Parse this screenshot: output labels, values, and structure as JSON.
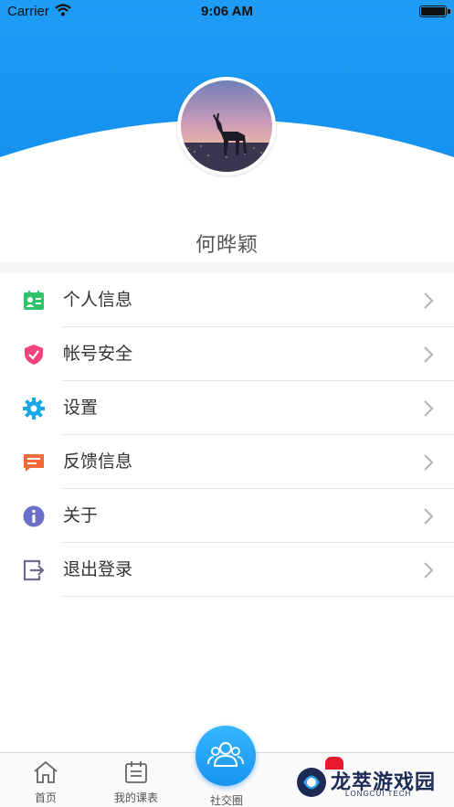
{
  "status_bar": {
    "carrier": "Carrier",
    "time": "9:06 AM"
  },
  "profile": {
    "username": "何晔颖"
  },
  "menu": {
    "items": [
      {
        "label": "个人信息",
        "icon": "id-card-icon",
        "color": "#2fc46a"
      },
      {
        "label": "帐号安全",
        "icon": "shield-check-icon",
        "color": "#f4427c"
      },
      {
        "label": "设置",
        "icon": "gear-icon",
        "color": "#1aa8e8"
      },
      {
        "label": "反馈信息",
        "icon": "message-icon",
        "color": "#f26a3a"
      },
      {
        "label": "关于",
        "icon": "info-icon",
        "color": "#6b6fc7"
      },
      {
        "label": "退出登录",
        "icon": "logout-icon",
        "color": "#6e6c8e"
      }
    ]
  },
  "tabbar": {
    "tabs": [
      {
        "label": "首页",
        "icon": "home-icon"
      },
      {
        "label": "我的课表",
        "icon": "calendar-icon"
      },
      {
        "label": "社交圈",
        "icon": "group-icon"
      }
    ]
  },
  "watermark": {
    "text": "龙萃游戏园",
    "sub": "LONGCUI TECH"
  },
  "colors": {
    "header_blue": "#1b9af5",
    "accent": "#1793ee"
  }
}
